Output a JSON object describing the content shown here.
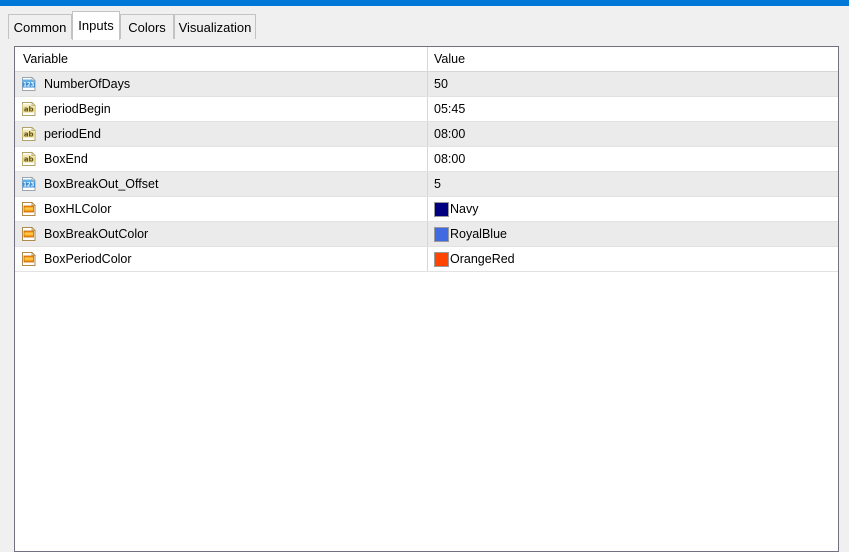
{
  "window": {
    "accent_color": "#0078d7",
    "background_color": "#f0f0f0"
  },
  "tabs": {
    "items": [
      {
        "label": "Common",
        "selected": false
      },
      {
        "label": "Inputs",
        "selected": true
      },
      {
        "label": "Colors",
        "selected": false
      },
      {
        "label": "Visualization",
        "selected": false
      }
    ]
  },
  "table": {
    "columns": [
      {
        "key": "variable",
        "label": "Variable"
      },
      {
        "key": "value",
        "label": "Value"
      }
    ],
    "rows": [
      {
        "icon": "numeric-type-icon",
        "variable": "NumberOfDays",
        "value": "50",
        "swatch": null
      },
      {
        "icon": "string-type-icon",
        "variable": "periodBegin",
        "value": "05:45",
        "swatch": null
      },
      {
        "icon": "string-type-icon",
        "variable": "periodEnd",
        "value": "08:00",
        "swatch": null
      },
      {
        "icon": "string-type-icon",
        "variable": "BoxEnd",
        "value": "08:00",
        "swatch": null
      },
      {
        "icon": "numeric-type-icon",
        "variable": "BoxBreakOut_Offset",
        "value": "5",
        "swatch": null
      },
      {
        "icon": "color-type-icon",
        "variable": "BoxHLColor",
        "value": "Navy",
        "swatch": "#000080"
      },
      {
        "icon": "color-type-icon",
        "variable": "BoxBreakOutColor",
        "value": "RoyalBlue",
        "swatch": "#4169E1"
      },
      {
        "icon": "color-type-icon",
        "variable": "BoxPeriodColor",
        "value": "OrangeRed",
        "swatch": "#FF4500"
      }
    ]
  }
}
